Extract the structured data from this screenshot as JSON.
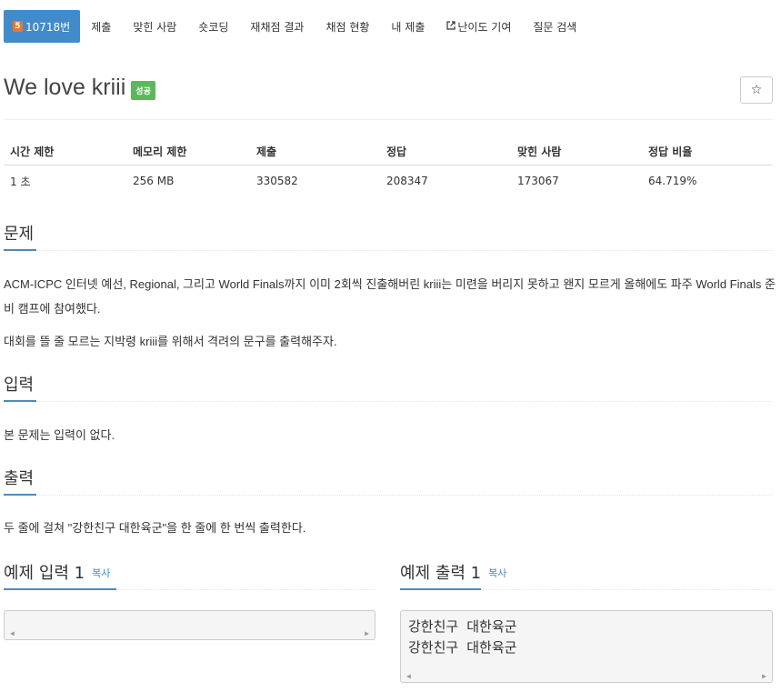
{
  "nav": {
    "problem_badge": "5",
    "problem_number": "10718번",
    "items": [
      "제출",
      "맞힌 사람",
      "숏코딩",
      "재채점 결과",
      "채점 현황",
      "내 제출",
      "난이도 기여",
      "질문 검색"
    ]
  },
  "problem": {
    "title": "We love kriii",
    "status_label": "성공",
    "star_icon": "☆"
  },
  "info_table": {
    "headers": [
      "시간 제한",
      "메모리 제한",
      "제출",
      "정답",
      "맞힌 사람",
      "정답 비율"
    ],
    "values": [
      "1 초",
      "256 MB",
      "330582",
      "208347",
      "173067",
      "64.719%"
    ]
  },
  "sections": {
    "description_title": "문제",
    "description_p1": "ACM-ICPC 인터넷 예선, Regional, 그리고 World Finals까지 이미 2회씩 진출해버린 kriii는 미련을 버리지 못하고 왠지 모르게 올해에도 파주 World Finals 준비 캠프에 참여했다.",
    "description_p2": "대회를 뜰 줄 모르는 지박령 kriii를 위해서 격려의 문구를 출력해주자.",
    "input_title": "입력",
    "input_text": "본 문제는 입력이 없다.",
    "output_title": "출력",
    "output_text": "두 줄에 걸쳐 \"강한친구 대한육군\"을 한 줄에 한 번씩 출력한다."
  },
  "samples": {
    "input_title": "예제 입력 1",
    "output_title": "예제 출력 1",
    "copy_label": "복사",
    "input_value": "",
    "output_value": "강한친구 대한육군\n강한친구 대한육군"
  }
}
